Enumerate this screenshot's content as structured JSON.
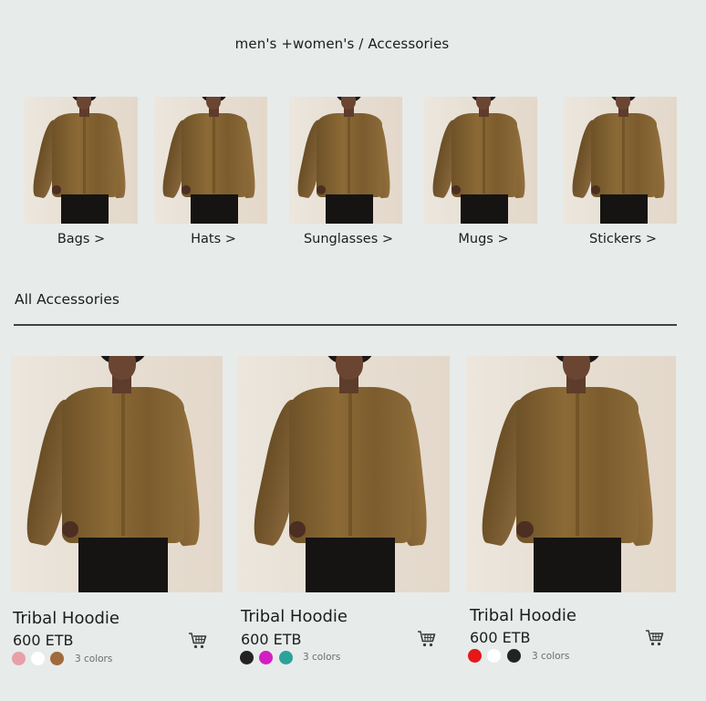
{
  "breadcrumb": "men's +women's / Accessories",
  "categories": [
    {
      "label": "Bags >",
      "image": "model-in-brown-shirt"
    },
    {
      "label": "Hats >",
      "image": "model-in-brown-shirt"
    },
    {
      "label": "Sunglasses >",
      "image": "model-in-brown-shirt"
    },
    {
      "label": "Mugs >",
      "image": "model-in-brown-shirt"
    },
    {
      "label": "Stickers >",
      "image": "model-in-brown-shirt"
    }
  ],
  "section_title": "All Accessories",
  "products": [
    {
      "name": "Tribal Hoodie",
      "price": "600 ETB",
      "colors_label": "3 colors",
      "swatches": [
        "#e8a0a8",
        "#ffffff",
        "#a06a3c"
      ],
      "cart_icon": "cart-icon"
    },
    {
      "name": "Tribal Hoodie",
      "price": "600 ETB",
      "colors_label": "3 colors",
      "swatches": [
        "#232323",
        "#d21ec3",
        "#2aa39b"
      ],
      "cart_icon": "cart-icon"
    },
    {
      "name": "Tribal Hoodie",
      "price": "600 ETB",
      "colors_label": "3 colors",
      "swatches": [
        "#e51818",
        "#ffffff",
        "#232323"
      ],
      "cart_icon": "cart-icon"
    }
  ]
}
